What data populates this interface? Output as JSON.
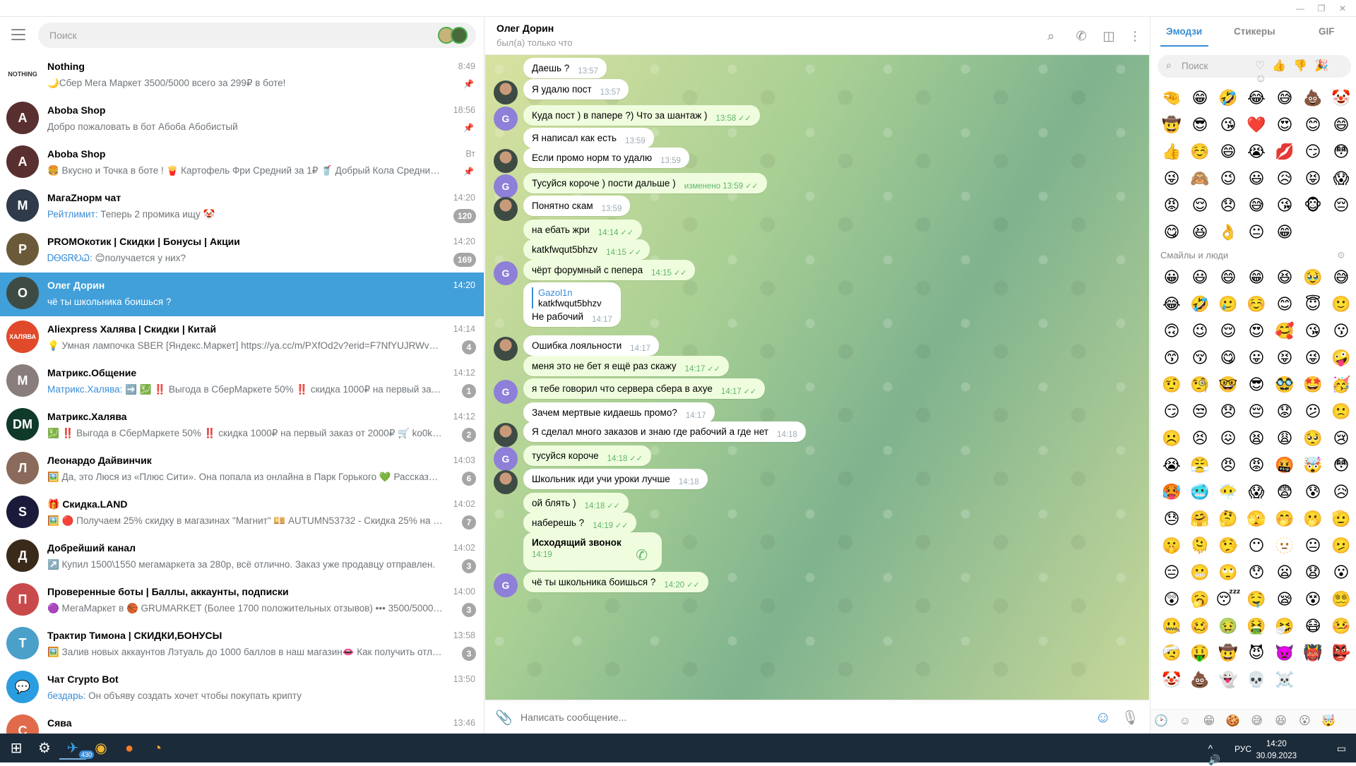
{
  "left": {
    "search_placeholder": "Поиск",
    "chats": [
      {
        "title": "Nothing",
        "preview": "🌙Сбер Мега Маркет 3500/5000 всего за 299₽ в боте!",
        "time": "8:49",
        "badge": "",
        "pinned": true,
        "icon": "📢",
        "avatar_color": "#ffffff",
        "avatar_text": "NOTHING"
      },
      {
        "title": "Aboba Shop",
        "preview": "Добро пожаловать в бот Абоба Абобистый",
        "time": "18:56",
        "badge": "",
        "pinned": true,
        "icon": "📢",
        "avatar_color": "#5a2f2f",
        "avatar_text": "A"
      },
      {
        "title": "Aboba Shop",
        "preview": "🍔 Вкусно и Точка в боте ! 🍟 Картофель Фри Средний за 1₽ 🥤 Добрый Кола Средний за 1...",
        "time": "Вт",
        "badge": "",
        "pinned": true,
        "icon": "📢",
        "avatar_color": "#5a2f2f",
        "avatar_text": "A"
      },
      {
        "title": "МагаZнорм чат",
        "preview_sender": "Рейтлимит:",
        "preview": " Теперь 2 промика ищу 🤡",
        "time": "14:20",
        "badge": "120",
        "pinned": false,
        "icon": "👥",
        "avatar_color": "#2f3a4a",
        "avatar_text": "М"
      },
      {
        "title": "PROMOкотик | Скидки | Бонусы | Акции",
        "preview_sender": "ᎠᎾᎶᏒᎧᏇ:",
        "preview": " 😊получается у них?",
        "time": "14:20",
        "badge": "169",
        "pinned": false,
        "icon": "👥",
        "avatar_color": "#6b5a3a",
        "avatar_text": "P"
      },
      {
        "title": "Олег Дорин",
        "preview": "чё ты школьника боишься ?",
        "time": "14:20",
        "badge": "",
        "pinned": false,
        "icon": "",
        "avatar_color": "#3d4b44",
        "avatar_text": "О",
        "active": true
      },
      {
        "title": "Aliexpress Халява | Скидки | Китай",
        "preview": "💡 Умная лампочка SBER [Яндекс.Маркет]  https://ya.cc/m/PXfOd2v?erid=F7NfYUJRWv19Yrm...",
        "time": "14:14",
        "badge": "4",
        "pinned": false,
        "icon": "📢",
        "avatar_color": "#e04a2a",
        "avatar_text": "ХАЛЯВА"
      },
      {
        "title": "Матрикс.Общение",
        "preview_sender": "Матрикс.Халява:",
        "preview": " ➡️ 💹 ‼️ Выгода в СберМаркете 50% ‼️  скидка 1000₽ на первый заказ от 2...",
        "time": "14:12",
        "badge": "1",
        "pinned": false,
        "icon": "👥",
        "avatar_color": "#8a7d7d",
        "avatar_text": "М"
      },
      {
        "title": "Матрикс.Халява",
        "preview": "💹 ‼️ Выгода в СберМаркете 50% ‼️  скидка 1000₽ на первый заказ от 2000₽ 🛒 ko0k8aef8 ...",
        "time": "14:12",
        "badge": "2",
        "pinned": false,
        "icon": "📢",
        "avatar_color": "#0f3a2a",
        "avatar_text": "DM"
      },
      {
        "title": "Леонардо Дайвинчик",
        "preview": "🖼️ Да, это Люся из «Плюс Сити». Она попала из онлайна в Парк Горького 💚  Рассказывае...",
        "time": "14:03",
        "badge": "6",
        "pinned": false,
        "icon": "📢",
        "avatar_color": "#8a6a5a",
        "avatar_text": "Л"
      },
      {
        "title": "🎁 Скидка.LAND",
        "preview": "🖼️ 🔴 Получаем 25% скидку в магазинах \"Магнит\"  💴 AUTUMN53732 - Скидка 25% на первы...",
        "time": "14:02",
        "badge": "7",
        "pinned": false,
        "icon": "📢",
        "avatar_color": "#1a1a3a",
        "avatar_text": "S"
      },
      {
        "title": "Добрейший канал",
        "preview": "↗️ Купил 1500\\1550 мегамаркета за 280р, всё отлично. Заказ уже продавцу отправлен.",
        "time": "14:02",
        "badge": "3",
        "pinned": false,
        "icon": "📢",
        "avatar_color": "#3a2a1a",
        "avatar_text": "Д"
      },
      {
        "title": "Проверенные боты | Баллы, аккаунты, подписки",
        "preview": "🟣 МегаМаркет в 🏀 GRUMARKET (Более 1700 положительных отзывов)  ••• 3500/5000 •••  ...",
        "time": "14:00",
        "badge": "3",
        "pinned": false,
        "icon": "📢",
        "avatar_color": "#c94a4a",
        "avatar_text": "П"
      },
      {
        "title": "Трактир Тимона | СКИДКИ,БОНУСЫ",
        "preview": "🖼️ Залив новых аккаунтов Лэтуаль до 1000 баллов в наш магазин👄  Как получить отличную с...",
        "time": "13:58",
        "badge": "3",
        "pinned": false,
        "icon": "📢",
        "avatar_color": "#4aa0c9",
        "avatar_text": "Т"
      },
      {
        "title": "Чат Crypto Bot",
        "preview_sender": "бездарь:",
        "preview": " Он объяву создать хочет чтобы покупать крипту",
        "time": "13:50",
        "badge": "",
        "pinned": false,
        "icon": "👥",
        "avatar_color": "#2a9de0",
        "avatar_text": "💬"
      },
      {
        "title": "Сява",
        "preview": "",
        "time": "13:46",
        "badge": "",
        "pinned": false,
        "icon": "",
        "avatar_color": "#e06a4a",
        "avatar_text": "С"
      }
    ]
  },
  "chat": {
    "peer_name": "Олег Дорин",
    "peer_status": "был(а) только что",
    "composer_placeholder": "Написать сообщение...",
    "messages": [
      {
        "text": "Даешь ?",
        "time": "13:57",
        "out": false,
        "avatar": ""
      },
      {
        "text": "Я удалю пост",
        "time": "13:57",
        "out": false,
        "avatar": "p"
      },
      {
        "text": "Куда пост ) в папере ?) Что за шантаж )",
        "time": "13:58",
        "out": true,
        "avatar": "g"
      },
      {
        "text": "Я написал как есть",
        "time": "13:59",
        "out": false,
        "avatar": ""
      },
      {
        "text": "Если промо норм то удалю",
        "time": "13:59",
        "out": false,
        "avatar": "p"
      },
      {
        "text": "Тусуйся короче ) пости дальше )",
        "time": "изменено 13:59",
        "out": true,
        "avatar": "g"
      },
      {
        "text": "Понятно скам",
        "time": "13:59",
        "out": false,
        "avatar": "p"
      },
      {
        "text": "на ебать жри",
        "time": "14:14",
        "out": true,
        "avatar": ""
      },
      {
        "text": "katkfwqut5bhzv",
        "time": "14:15",
        "out": true,
        "avatar": ""
      },
      {
        "text": "чёрт форумный с пепера",
        "time": "14:15",
        "out": true,
        "avatar": "g"
      },
      {
        "text": "Не рабочий",
        "time": "14:17",
        "out": false,
        "avatar": "",
        "reply_name": "Gazol1n",
        "reply_text": "katkfwqut5bhzv"
      },
      {
        "text": "Ошибка лояльности",
        "time": "14:17",
        "out": false,
        "avatar": "p"
      },
      {
        "text": "меня это не бет я ещё раз скажу",
        "time": "14:17",
        "out": true,
        "avatar": ""
      },
      {
        "text": "я тебе говорил что сервера сбера в ахуе",
        "time": "14:17",
        "out": true,
        "avatar": "g"
      },
      {
        "text": "Зачем мертвые кидаешь промо?",
        "time": "14:17",
        "out": false,
        "avatar": ""
      },
      {
        "text": "Я сделал много заказов и знаю где рабочий а где нет",
        "time": "14:18",
        "out": false,
        "avatar": "p"
      },
      {
        "text": "тусуйся короче",
        "time": "14:18",
        "out": true,
        "avatar": "g"
      },
      {
        "text": "Школьник иди учи уроки лучше",
        "time": "14:18",
        "out": false,
        "avatar": "p"
      },
      {
        "text": "ой блять )",
        "time": "14:18",
        "out": true,
        "avatar": ""
      },
      {
        "text": "наберешь ?",
        "time": "14:19",
        "out": true,
        "avatar": ""
      },
      {
        "text": "Исходящий звонок",
        "time": "14:19",
        "out": true,
        "avatar": "",
        "call": true
      },
      {
        "text": "чё ты школьника боишься ?",
        "time": "14:20",
        "out": true,
        "avatar": "g"
      }
    ]
  },
  "emoji_panel": {
    "tabs": [
      "Эмодзи",
      "Стикеры",
      "GIF"
    ],
    "search_placeholder": "Поиск",
    "recent": [
      "🤏",
      "😁",
      "🤣",
      "😂",
      "😅",
      "💩",
      "🤡",
      "🤠",
      "😎",
      "😘",
      "❤️",
      "😍",
      "😊",
      "😄",
      "👍",
      "☺️",
      "😄",
      "😭",
      "💋",
      "😏",
      "😳",
      "😜",
      "🙈",
      "😉",
      "😃",
      "😥",
      "😝",
      "😱",
      "😡",
      "😌",
      "😞",
      "😅",
      "😘",
      "🐵",
      "😔",
      "😋",
      "😆",
      "👌",
      "😐",
      "😁"
    ],
    "section_title": "Смайлы и люди",
    "people": [
      "😀",
      "😃",
      "😄",
      "😁",
      "😆",
      "🥹",
      "😅",
      "😂",
      "🤣",
      "🥲",
      "☺️",
      "😊",
      "😇",
      "🙂",
      "🙃",
      "😉",
      "😌",
      "😍",
      "🥰",
      "😘",
      "😗",
      "😙",
      "😚",
      "😋",
      "😛",
      "😝",
      "😜",
      "🤪",
      "🤨",
      "🧐",
      "🤓",
      "😎",
      "🥸",
      "🤩",
      "🥳",
      "😏",
      "😒",
      "😞",
      "😔",
      "😟",
      "😕",
      "🙁",
      "☹️",
      "😣",
      "😖",
      "😫",
      "😩",
      "🥺",
      "😢",
      "😭",
      "😤",
      "😠",
      "😡",
      "🤬",
      "🤯",
      "😳",
      "🥵",
      "🥶",
      "😶‍🌫️",
      "😱",
      "😨",
      "😰",
      "😥",
      "😓",
      "🤗",
      "🤔",
      "🫣",
      "🤭",
      "🫢",
      "🫡",
      "🤫",
      "🫠",
      "🤥",
      "😶",
      "🫥",
      "😐",
      "🫤",
      "😑",
      "😬",
      "🙄",
      "😯",
      "😦",
      "😧",
      "😮",
      "😲",
      "🥱",
      "😴",
      "🤤",
      "😪",
      "😵",
      "😵‍💫",
      "🤐",
      "🥴",
      "🤢",
      "🤮",
      "🤧",
      "😷",
      "🤒",
      "🤕",
      "🤑",
      "🤠",
      "😈",
      "👿",
      "👹",
      "👺",
      "🤡",
      "💩",
      "👻",
      "💀",
      "☠️"
    ]
  },
  "taskbar": {
    "telegram_badge": "430",
    "lang": "РУС",
    "time": "14:20",
    "date": "30.09.2023"
  }
}
